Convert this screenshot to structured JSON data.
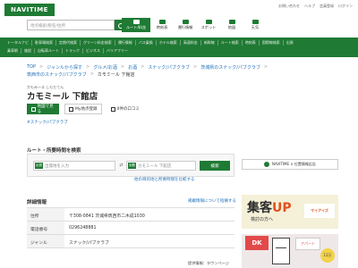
{
  "header": {
    "logo": "NAVITIME",
    "search_placeholder": "地点検索/駅名/住所",
    "top_links": [
      "お問い合わせ",
      "ヘルプ",
      "会員登録",
      "ログイン"
    ],
    "nav_tabs": [
      {
        "label": "ルート/料金",
        "active": true
      },
      {
        "label": "時刻表",
        "active": false
      },
      {
        "label": "運行情報",
        "active": false
      },
      {
        "label": "スポット",
        "active": false
      },
      {
        "label": "地図",
        "active": false
      },
      {
        "label": "天気",
        "active": false
      }
    ]
  },
  "subnav": {
    "row1": [
      "トータルナビ",
      "駐車場検索",
      "定期代検索",
      "グリーン料金検索",
      "運行情報",
      "バス乗換",
      "ホテル検索",
      "高速料金",
      "新幹線",
      "ルート検索",
      "時刻表",
      "国際線検索",
      "出張"
    ],
    "row2": [
      "乗車駅",
      "施設",
      "自転車ルート",
      "トラック",
      "ビジネス",
      "バリアフリー"
    ]
  },
  "breadcrumb": {
    "line1": [
      "TOP",
      "ジャンルから探す",
      "グルメ/お酒",
      "お酒",
      "スナック/パブクラブ",
      "茨城県のスナック/パブクラブ"
    ],
    "line2": [
      "筑西市のスナック/パブクラブ"
    ],
    "current": "カモミール 下館店"
  },
  "spot": {
    "ruby": "かもみーる しもだてん",
    "title": "カモミール 下館店"
  },
  "actions": {
    "map_button": "地図で見る",
    "my_spot_button": "My地点登録",
    "kuchikomi": "0件の口コミ"
  },
  "share_link": "#スナック/パブクラブ",
  "route_search": {
    "heading": "ルート・所要時間を検索",
    "from_tag": "出発",
    "from_placeholder": "出発地を入力",
    "to_tag": "到着",
    "to_value": "カモミール 下館店",
    "search_button": "検索",
    "more_link": "他の目的地と所要時間を比較する"
  },
  "details": {
    "heading": "詳細情報",
    "report_link": "掲載情報について指摘する",
    "rows": [
      {
        "key": "住所",
        "value": "〒308-0841 茨城県筑西市二木成1030"
      },
      {
        "key": "電話番号",
        "value": "0296248881"
      },
      {
        "key": "ジャンル",
        "value": "スナック/パブクラブ"
      }
    ],
    "provider": "提供情報：タウンページ"
  },
  "sidebar": {
    "banner": "NAVITIME × 位置情報広告",
    "ad1_big_a": "集客",
    "ad1_big_b": "UP",
    "ad1_sub": "検討の方へ",
    "ad1_logo": "マイアイズ",
    "ad2_tag": "DK",
    "ad2_plan_label": "6.9帖",
    "ad2_pin": "アパート",
    "ad2_badge": "11万"
  },
  "colors": {
    "brand_green": "#1f7a34",
    "link_blue": "#1f6fb8",
    "accent_orange": "#e0521c"
  }
}
